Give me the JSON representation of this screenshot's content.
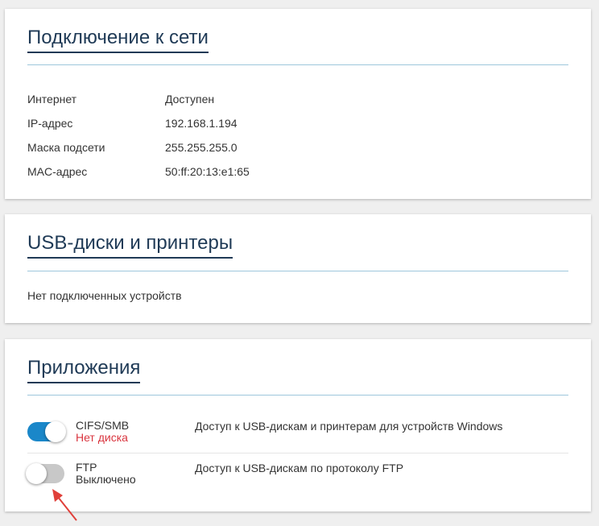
{
  "network": {
    "title": "Подключение к сети",
    "rows": [
      {
        "key": "Интернет",
        "value": "Доступен"
      },
      {
        "key": "IP-адрес",
        "value": "192.168.1.194"
      },
      {
        "key": "Маска подсети",
        "value": "255.255.255.0"
      },
      {
        "key": "MAC-адрес",
        "value": "50:ff:20:13:e1:65"
      }
    ]
  },
  "usb": {
    "title": "USB-диски и принтеры",
    "empty_text": "Нет подключенных устройств"
  },
  "apps": {
    "title": "Приложения",
    "items": [
      {
        "name": "CIFS/SMB",
        "status": "Нет диска",
        "status_color": "#d9353f",
        "description": "Доступ к USB-дискам и принтерам для устройств Windows",
        "enabled": true
      },
      {
        "name": "FTP",
        "status": "Выключено",
        "status_color": "#333333",
        "description": "Доступ к USB-дискам по протоколу FTP",
        "enabled": false
      }
    ]
  },
  "colors": {
    "toggle_on": "#1a87c9",
    "toggle_off": "#c8c8c8",
    "heading": "#1f3a56",
    "annotation_arrow": "#e0403a"
  }
}
